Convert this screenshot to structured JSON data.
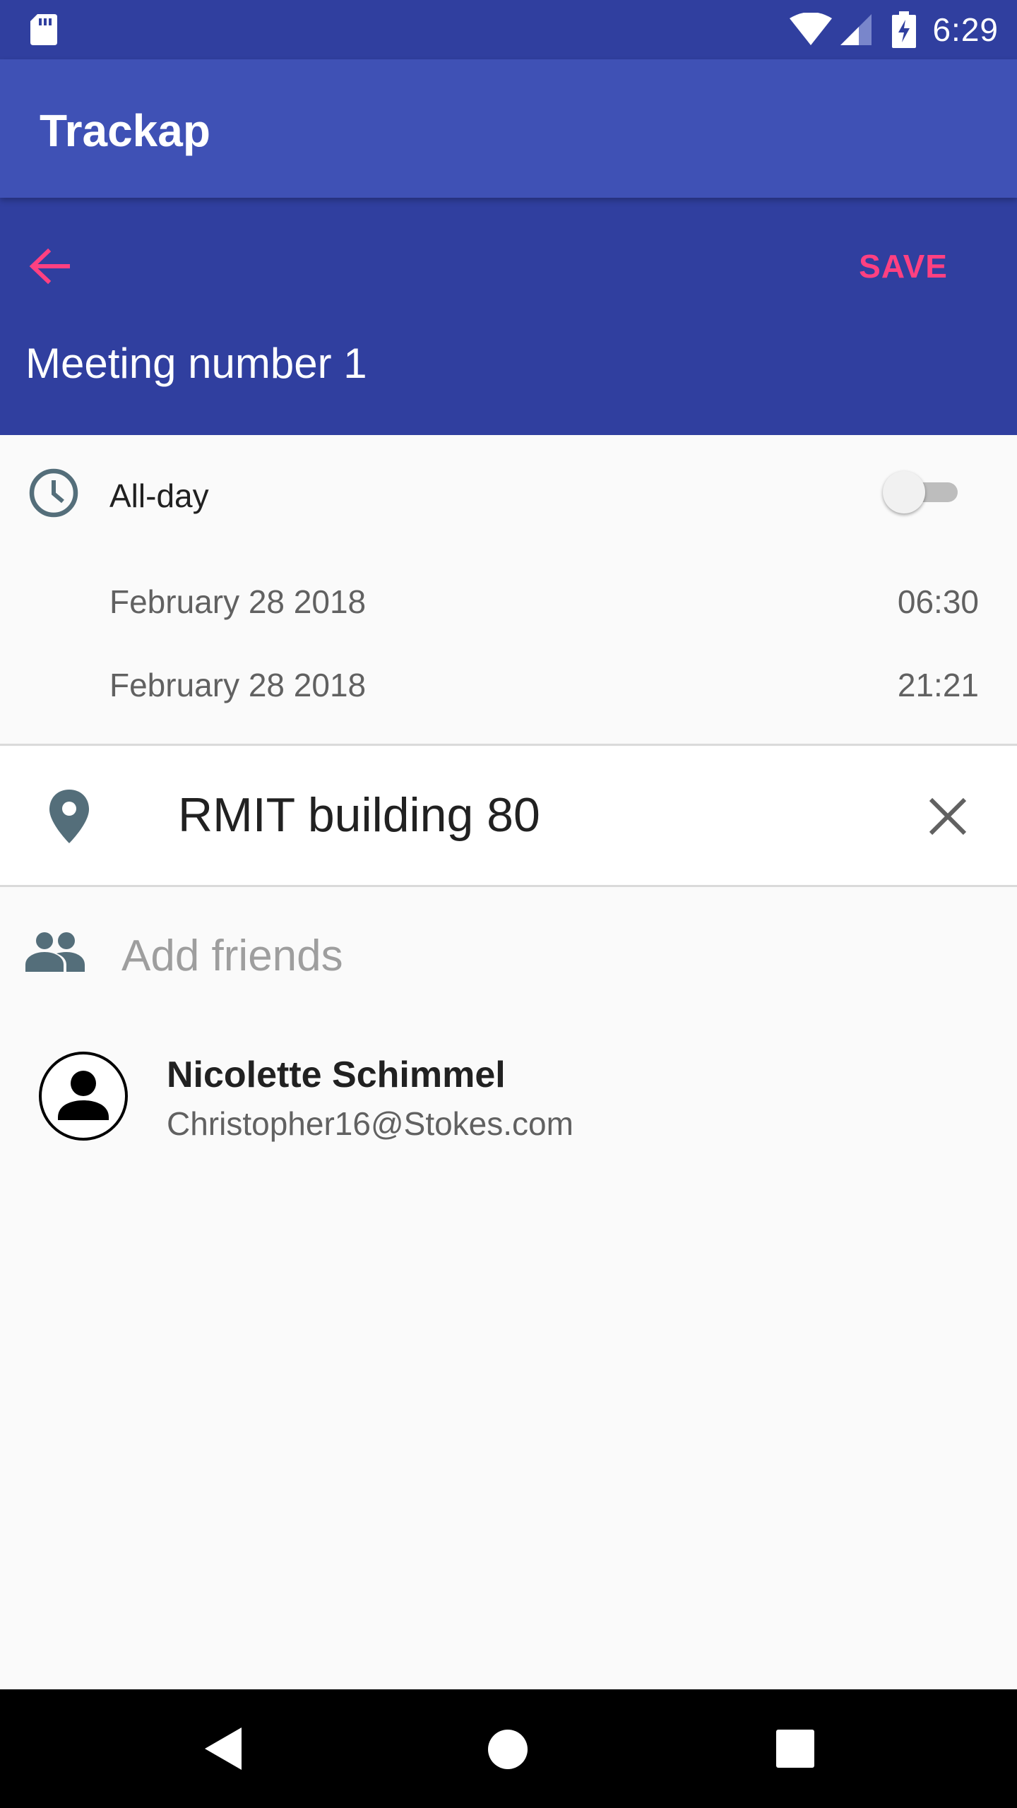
{
  "status_bar": {
    "time": "6:29",
    "icons": [
      "sd-card-icon",
      "wifi-icon",
      "cell-signal-icon",
      "battery-charging-icon"
    ]
  },
  "app_bar": {
    "title": "Trackap"
  },
  "editor": {
    "back_icon": "arrow-back-icon",
    "save_label": "SAVE",
    "event_title": "Meeting number 1",
    "accent_color": "#ff4081",
    "header_color": "#303f9f"
  },
  "time_section": {
    "icon": "clock-icon",
    "allday_label": "All-day",
    "allday_enabled": false,
    "start_date": "February 28 2018",
    "start_time": "06:30",
    "end_date": "February 28 2018",
    "end_time": "21:21"
  },
  "location": {
    "icon": "place-icon",
    "value": "RMIT building 80",
    "clear_icon": "close-icon"
  },
  "friends": {
    "icon": "people-icon",
    "placeholder": "Add friends",
    "list": [
      {
        "name": "Nicolette Schimmel",
        "email": "Christopher16@Stokes.com",
        "avatar_icon": "account-circle-icon"
      }
    ]
  },
  "nav_bar": {
    "icons": [
      "nav-back-icon",
      "nav-home-icon",
      "nav-recents-icon"
    ]
  }
}
